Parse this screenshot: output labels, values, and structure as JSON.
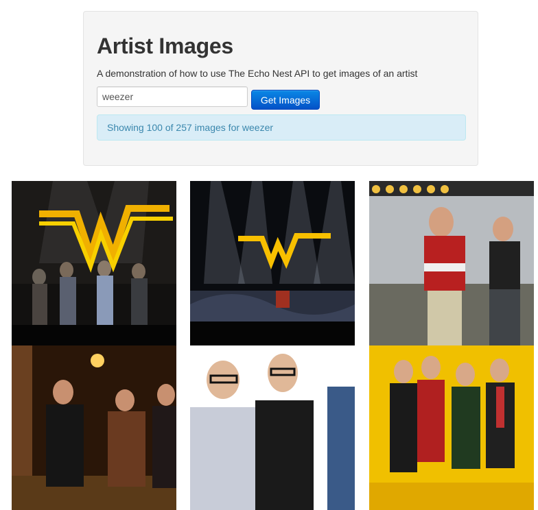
{
  "header": {
    "title": "Artist Images",
    "description": "A demonstration of how to use The Echo Nest API to get images of an artist"
  },
  "search": {
    "value": "weezer",
    "button_label": "Get Images"
  },
  "status": {
    "message": "Showing 100 of 257 images for weezer"
  },
  "colors": {
    "button": "#0a72da",
    "alert_bg": "#d9edf7",
    "alert_text": "#3a87ad"
  },
  "gallery": {
    "images": [
      {
        "alt": "weezer concert with W sign"
      },
      {
        "alt": "weezer on stage under spotlights"
      },
      {
        "alt": "weezer singer performing outdoors"
      },
      {
        "alt": "weezer band at night on street"
      },
      {
        "alt": "weezer band portrait on white"
      },
      {
        "alt": "weezer band portrait on yellow"
      }
    ]
  }
}
